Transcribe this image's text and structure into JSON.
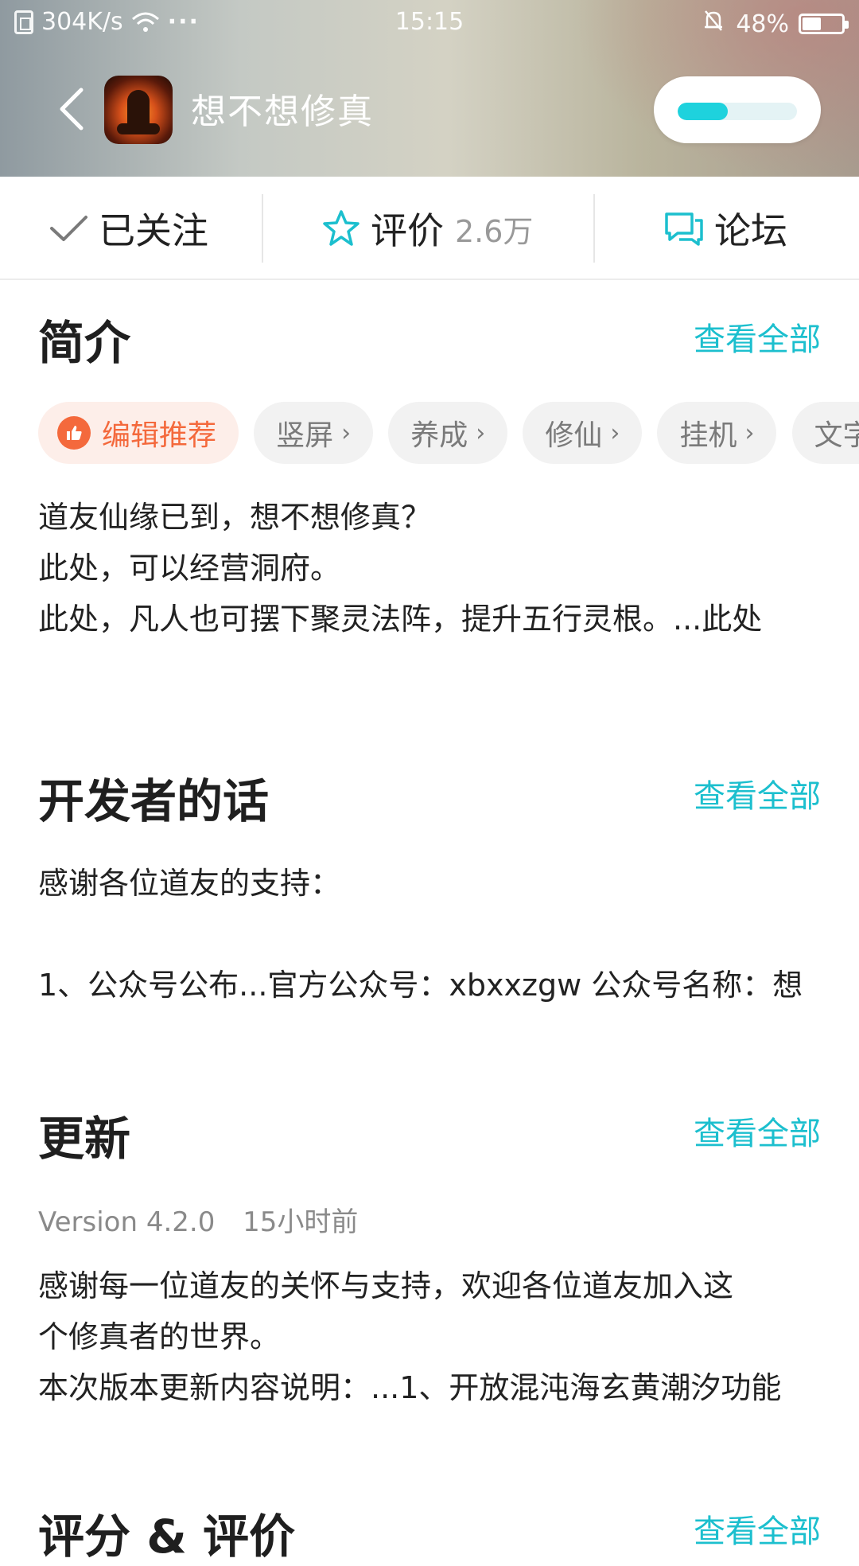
{
  "status_bar": {
    "speed": "304K/s",
    "more": "···",
    "time": "15:15",
    "battery_percent": "48%",
    "battery_level": 0.48
  },
  "header": {
    "app_name": "想不想修真",
    "download_progress": 0.42
  },
  "actions": {
    "follow_label": "已关注",
    "rate_label": "评价",
    "rate_count": "2.6万",
    "forum_label": "论坛"
  },
  "intro": {
    "title": "简介",
    "view_all": "查看全部",
    "tags": [
      {
        "label": "编辑推荐"
      },
      {
        "label": "竖屏"
      },
      {
        "label": "养成"
      },
      {
        "label": "修仙"
      },
      {
        "label": "挂机"
      },
      {
        "label": "文字"
      }
    ],
    "lines": [
      "道友仙缘已到，想不想修真？",
      "此处，可以经营洞府。",
      "此处，凡人也可摆下聚灵法阵，提升五行灵根。...此处"
    ]
  },
  "developer": {
    "title": "开发者的话",
    "view_all": "查看全部",
    "lines": [
      "感谢各位道友的支持：",
      "1、公众号公布...官方公众号：xbxxzgw 公众号名称：想"
    ]
  },
  "update": {
    "title": "更新",
    "view_all": "查看全部",
    "version": "Version 4.2.0",
    "time_ago": "15小时前",
    "lines": [
      "感谢每一位道友的关怀与支持，欢迎各位道友加入这",
      "个修真者的世界。",
      "本次版本更新内容说明：...1、开放混沌海玄黄潮汐功能"
    ]
  },
  "ratings": {
    "title": "评分 & 评价",
    "view_all": "查看全部"
  }
}
